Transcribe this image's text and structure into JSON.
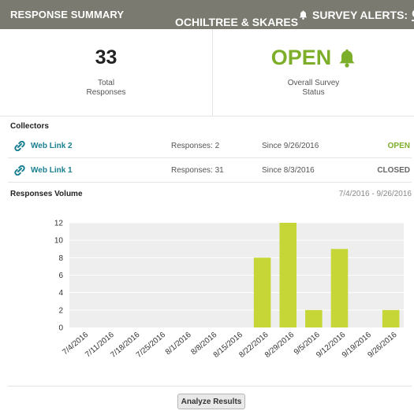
{
  "header": {
    "title": "RESPONSE SUMMARY",
    "survey_name": "OCHILTREE & SKARES",
    "alerts_label": "SURVEY ALERTS:",
    "alerts_value": "ON"
  },
  "stats": {
    "total_value": "33",
    "total_label_line1": "Total",
    "total_label_line2": "Responses",
    "status_value": "OPEN",
    "status_label_line1": "Overall Survey",
    "status_label_line2": "Status"
  },
  "collectors": {
    "heading": "Collectors",
    "items": [
      {
        "name": "Web Link 2",
        "responses": "Responses: 2",
        "since": "Since 9/26/2016",
        "status": "OPEN"
      },
      {
        "name": "Web Link 1",
        "responses": "Responses: 31",
        "since": "Since 8/3/2016",
        "status": "CLOSED"
      }
    ]
  },
  "volume": {
    "heading": "Responses Volume",
    "range": "7/4/2016 - 9/26/2016"
  },
  "chart_data": {
    "type": "bar",
    "categories": [
      "7/4/2016",
      "7/11/2016",
      "7/18/2016",
      "7/25/2016",
      "8/1/2016",
      "8/8/2016",
      "8/15/2016",
      "8/22/2016",
      "8/29/2016",
      "9/5/2016",
      "9/12/2016",
      "9/19/2016",
      "9/26/2016"
    ],
    "values": [
      0,
      0,
      0,
      0,
      0,
      0,
      0,
      8,
      12,
      2,
      9,
      0,
      2
    ],
    "yticks": [
      0,
      2,
      4,
      6,
      8,
      10,
      12
    ],
    "ylim": [
      0,
      12
    ],
    "bar_color": "#c5d636",
    "plot_background": "#eeeeee",
    "grid": true,
    "title": "",
    "xlabel": "",
    "ylabel": ""
  },
  "footer": {
    "analyze_label": "Analyze Results"
  },
  "colors": {
    "header_bg": "#7a7a70",
    "open_green": "#7cae29",
    "link_teal": "#1a8090",
    "closed_gray": "#666666"
  },
  "icons": {
    "alert": "bell-icon",
    "status": "bell-icon",
    "collector": "link-icon"
  }
}
